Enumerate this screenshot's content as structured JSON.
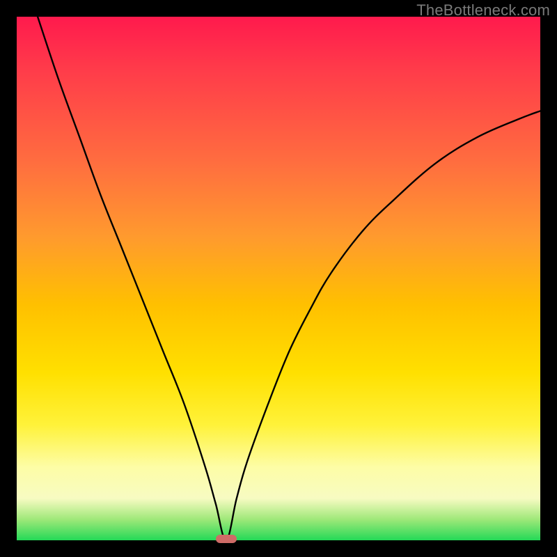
{
  "watermark": "TheBottleneck.com",
  "colors": {
    "frame": "#000000",
    "gradient_top": "#ff1a4d",
    "gradient_mid1": "#ff9a2e",
    "gradient_mid2": "#ffe000",
    "gradient_bottom": "#24d957",
    "curve": "#000000",
    "marker": "#cf6b67",
    "watermark": "#7a7a7a"
  },
  "chart_data": {
    "type": "line",
    "title": "",
    "xlabel": "",
    "ylabel": "",
    "xlim": [
      0,
      100
    ],
    "ylim": [
      0,
      100
    ],
    "grid": false,
    "note": "Y is treated as vertical position within plot area; 0 = bottom (green), 100 = top (red). Curve is a V-shaped bottleneck profile with minimum near x≈40.",
    "minimum": {
      "x": 40,
      "y": 0
    },
    "marker": {
      "x": 40,
      "y": 0
    },
    "series": [
      {
        "name": "bottleneck-curve",
        "x": [
          4,
          8,
          12,
          16,
          20,
          24,
          28,
          32,
          36,
          38,
          40,
          42,
          44,
          48,
          52,
          56,
          60,
          66,
          72,
          80,
          88,
          96,
          100
        ],
        "y": [
          100,
          88,
          77,
          66,
          56,
          46,
          36,
          26,
          14,
          7,
          0,
          8,
          15,
          26,
          36,
          44,
          51,
          59,
          65,
          72,
          77,
          80.5,
          82
        ]
      }
    ]
  }
}
